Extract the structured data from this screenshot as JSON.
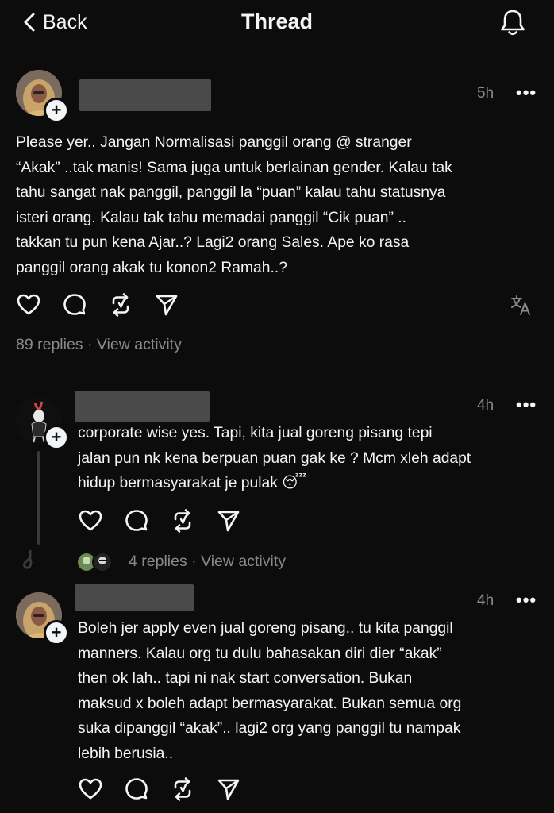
{
  "header": {
    "back_label": "Back",
    "title": "Thread"
  },
  "main_post": {
    "time": "5h",
    "text": "Please yer.. Jangan Normalisasi panggil orang @ stranger\n“Akak” ..tak manis! Sama juga untuk berlainan gender. Kalau tak\ntahu sangat nak panggil, panggil la “puan” kalau tahu statusnya\nisteri orang. Kalau tak tahu memadai panggil “Cik puan” ..\ntakkan tu pun kena Ajar..? Lagi2 orang Sales. Ape ko rasa\npanggil orang akak tu konon2 Ramah..?",
    "replies": "89 replies",
    "separator": "·",
    "view_activity": "View activity"
  },
  "reply1": {
    "time": "4h",
    "text": "corporate wise yes. Tapi, kita jual goreng pisang tepi\njalan pun nk kena berpuan puan gak ke ? Mcm xleh adapt\nhidup bermasyarakat je pulak 😴",
    "replies": "4 replies",
    "separator": "·",
    "view_activity": "View activity"
  },
  "reply2": {
    "time": "4h",
    "text": "Boleh jer apply even jual goreng pisang.. tu kita panggil\nmanners. Kalau org tu dulu bahasakan diri dier “akak”\nthen ok lah.. tapi ni nak start conversation. Bukan\nmaksud x boleh adapt bermasyarakat. Bukan semua org\nsuka dipanggil “akak”.. lagi2 org yang panggil tu nampak\nlebih berusia.."
  },
  "icons": {
    "more": "•••",
    "plus": "+"
  },
  "colors": {
    "background": "#0c0c0c",
    "text": "#f3f5f7",
    "secondary": "#8a8a8a",
    "redaction": "#4a4a4a"
  }
}
